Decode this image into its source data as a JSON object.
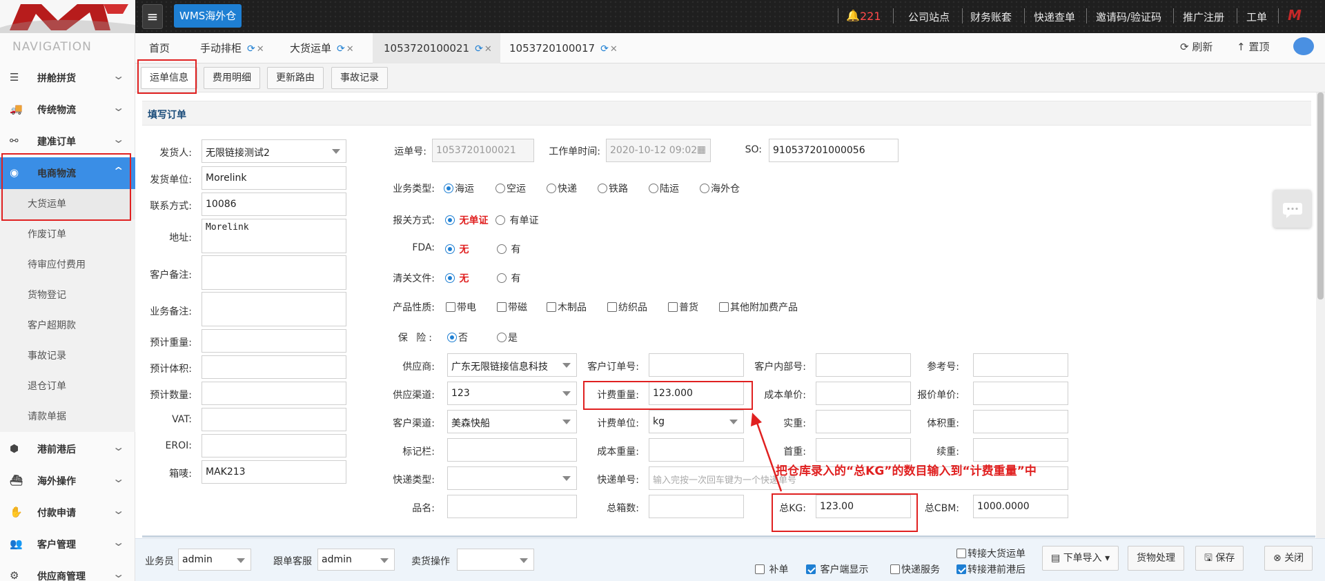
{
  "topbar": {
    "app_badge": "WMS海外仓",
    "notification_count": "221",
    "links": [
      "公司站点",
      "财务账套",
      "快递查单",
      "邀请码/验证码",
      "推广注册",
      "工单"
    ]
  },
  "sidebar": {
    "title": "NAVIGATION",
    "items": [
      {
        "label": "拼舱拼货",
        "icon": "list-icon"
      },
      {
        "label": "传统物流",
        "icon": "truck-icon"
      },
      {
        "label": "建准订单",
        "icon": "link-icon"
      },
      {
        "label": "电商物流",
        "icon": "globe-icon"
      },
      {
        "label": "港前港后",
        "icon": "cubes-icon"
      },
      {
        "label": "海外操作",
        "icon": "ship-icon"
      },
      {
        "label": "付款申请",
        "icon": "payment-icon"
      },
      {
        "label": "客户管理",
        "icon": "users-icon"
      },
      {
        "label": "供应商管理",
        "icon": "supplier-icon"
      }
    ],
    "subitems": [
      "大货运单",
      "作废订单",
      "待审应付费用",
      "货物登记",
      "客户超期款",
      "事故记录",
      "退仓订单",
      "请款单据"
    ]
  },
  "tabs": [
    {
      "label": "首页"
    },
    {
      "label": "手动排柜"
    },
    {
      "label": "大货运单"
    },
    {
      "label": "1053720100021"
    },
    {
      "label": "1053720100017"
    }
  ],
  "tools": {
    "refresh": "刷新",
    "top": "置顶"
  },
  "subtabs": [
    "运单信息",
    "费用明细",
    "更新路由",
    "事故记录"
  ],
  "panel_title": "填写订单",
  "left_form": {
    "shipper_label": "发货人:",
    "shipper": "无限链接测试2",
    "shipper_unit_label": "发货单位:",
    "shipper_unit": "Morelink",
    "contact_label": "联系方式:",
    "contact": "10086",
    "address_label": "地址:",
    "address": "Morelink",
    "customer_note_label": "客户备注:",
    "business_note_label": "业务备注:",
    "est_weight_label": "预计重量:",
    "est_volume_label": "预计体积:",
    "est_qty_label": "预计数量:",
    "vat_label": "VAT:",
    "eori_label": "EROI:",
    "mark_label": "箱唛:",
    "mark": "MAK213"
  },
  "right_form": {
    "waybill_label": "运单号:",
    "waybill": "1053720100021",
    "worktime_label": "工作单时间:",
    "worktime": "2020-10-12 09:02",
    "so_label": "SO:",
    "so": "910537201000056",
    "biz_type_label": "业务类型:",
    "biz_types": [
      "海运",
      "空运",
      "快递",
      "铁路",
      "陆运",
      "海外仓"
    ],
    "customs_label": "报关方式:",
    "customs_no": "无单证",
    "customs_yes": "有单证",
    "fda_label": "FDA:",
    "fda_no": "无",
    "fda_yes": "有",
    "clearance_label": "清关文件:",
    "clearance_no": "无",
    "clearance_yes": "有",
    "product_label": "产品性质:",
    "product_types": [
      "带电",
      "带磁",
      "木制品",
      "纺织品",
      "普货",
      "其他附加费产品"
    ],
    "insurance_label": "保 险:",
    "insurance_no": "否",
    "insurance_yes": "是",
    "supplier_label": "供应商:",
    "supplier": "广东无限链接信息科技",
    "cust_order_label": "客户订单号:",
    "cust_internal_label": "客户内部号:",
    "ref_label": "参考号:",
    "supplier_channel_label": "供应渠道:",
    "supplier_channel": "123",
    "charge_weight_label": "计费重量:",
    "charge_weight": "123.000",
    "cost_price_label": "成本单价:",
    "quote_price_label": "报价单价:",
    "cust_channel_label": "客户渠道:",
    "cust_channel": "美森快船",
    "charge_unit_label": "计费单位:",
    "charge_unit": "kg",
    "actual_weight_label": "实重:",
    "vol_weight_label": "体积重:",
    "mark_col_label": "标记栏:",
    "cost_weight_label": "成本重量:",
    "first_weight_label": "首重:",
    "next_weight_label": "续重:",
    "express_type_label": "快递类型:",
    "express_no_label": "快递单号:",
    "express_no_placeholder": "输入完按一次回车键为一个快递单号",
    "product_name_label": "品名:",
    "total_boxes_label": "总箱数:",
    "total_kg_label": "总KG:",
    "total_kg": "123.00",
    "total_cbm_label": "总CBM:",
    "total_cbm": "1000.0000"
  },
  "annotation": "把仓库录入的“总KG”的数目输入到“计费重量”中",
  "footer": {
    "salesman_label": "业务员",
    "salesman": "admin",
    "cs_label": "跟单客服",
    "cs": "admin",
    "seller_label": "卖货操作",
    "supplement": "补单",
    "client_display": "客户端显示",
    "express_service": "快递服务",
    "transfer_bulk": "转接大货运单",
    "transfer_port": "转接港前港后",
    "import": "下单导入",
    "cargo": "货物处理",
    "save": "保存",
    "close": "关闭"
  },
  "colors": {
    "accent": "#1e7fd3",
    "active_nav": "#3a8ee6",
    "annotation": "#e02020"
  }
}
